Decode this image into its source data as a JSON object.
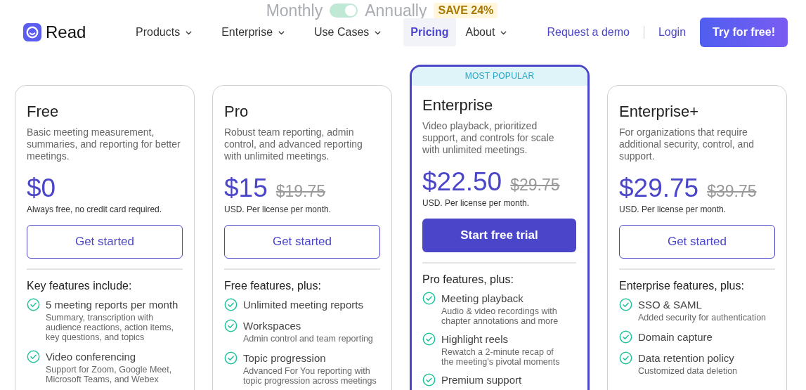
{
  "billing": {
    "monthly": "Monthly",
    "on": true,
    "annually": "Annually",
    "save": "SAVE 24%"
  },
  "logo": "Read",
  "nav": [
    {
      "label": "Products",
      "has_menu": true,
      "selected": false
    },
    {
      "label": "Enterprise",
      "has_menu": true,
      "selected": false
    },
    {
      "label": "Use Cases",
      "has_menu": true,
      "selected": false
    },
    {
      "label": "Pricing",
      "has_menu": false,
      "selected": true
    },
    {
      "label": "About",
      "has_menu": true,
      "selected": false
    }
  ],
  "request_demo": "Request a demo",
  "login": "Login",
  "try_button": "Try for free!",
  "plans": [
    {
      "name": "Free",
      "featured": false,
      "description": "Basic meeting measurement, summaries, and reporting for better meetings.",
      "price": "$0",
      "note": "Always free, no credit card required.",
      "button": {
        "label": "Get started",
        "kind": "outline"
      },
      "features_heading": "Key features include:",
      "features": [
        {
          "title": "5 meeting reports per month",
          "detail": "Summary, transcription with audience reactions, action items, key questions, and topics"
        },
        {
          "title": "Video conferencing",
          "detail": "Support for Zoom, Google Meet, Microsoft Teams, and Webex"
        }
      ]
    },
    {
      "name": "Pro",
      "featured": false,
      "description": "Robust team reporting, admin control, and advanced reporting with unlimited meetings.",
      "price": "$15",
      "old_price": "$19.75",
      "note": "USD. Per license per month.",
      "button": {
        "label": "Get started",
        "kind": "outline"
      },
      "features_heading": "Free features, plus:",
      "features": [
        {
          "title": "Unlimited meeting reports"
        },
        {
          "title": "Workspaces",
          "detail": "Admin control and team reporting"
        },
        {
          "title": "Topic progression",
          "detail": "Advanced For You reporting with topic progression across meetings"
        }
      ]
    },
    {
      "name": "Enterprise",
      "featured": true,
      "badge": "MOST POPULAR",
      "description": "Video playback, prioritized support, and controls for scale with unlimited meetings.",
      "price": "$22.50",
      "old_price": "$29.75",
      "note": "USD. Per license per month.",
      "button": {
        "label": "Start free trial",
        "kind": "filled"
      },
      "features_heading": "Pro features, plus:",
      "features": [
        {
          "title": "Meeting playback",
          "detail": "Audio & video recordings with chapter annotations and more"
        },
        {
          "title": "Highlight reels",
          "detail": "Rewatch a 2-minute recap of the meeting's pivotal moments"
        },
        {
          "title": "Premium support"
        }
      ]
    },
    {
      "name": "Enterprise+",
      "featured": false,
      "description": "For organizations that require additional security, control, and support.",
      "price": "$29.75",
      "old_price": "$39.75",
      "note": "USD. Per license per month.",
      "button": {
        "label": "Get started",
        "kind": "outline"
      },
      "features_heading": "Enterprise features, plus:",
      "features": [
        {
          "title": "SSO & SAML",
          "detail": "Added security for authentication"
        },
        {
          "title": "Domain capture"
        },
        {
          "title": "Data retention policy",
          "detail": "Customized data deletion"
        }
      ]
    }
  ]
}
